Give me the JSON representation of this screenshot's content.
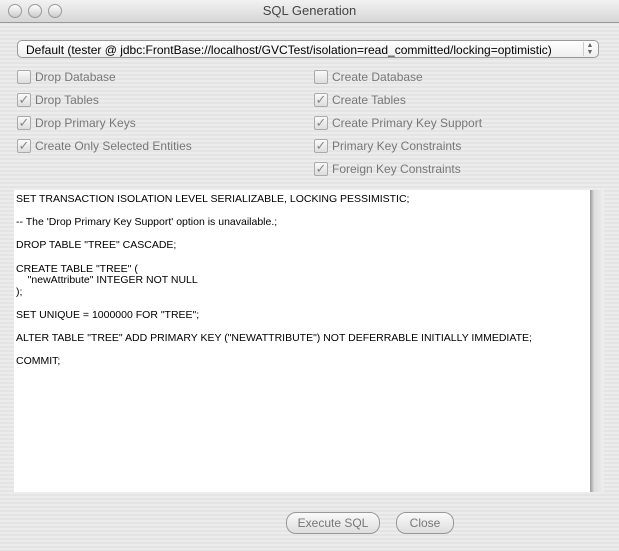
{
  "window": {
    "title": "SQL Generation"
  },
  "connection": {
    "selected": "Default (tester @ jdbc:FrontBase://localhost/GVCTest/isolation=read_committed/locking=optimistic)"
  },
  "options_left": [
    {
      "label": "Drop Database",
      "checked": false
    },
    {
      "label": "Drop Tables",
      "checked": true
    },
    {
      "label": "Drop Primary Keys",
      "checked": true
    },
    {
      "label": "Create Only Selected Entities",
      "checked": true
    }
  ],
  "options_right": [
    {
      "label": "Create Database",
      "checked": false
    },
    {
      "label": "Create Tables",
      "checked": true
    },
    {
      "label": "Create Primary Key Support",
      "checked": true
    },
    {
      "label": "Primary Key Constraints",
      "checked": true
    },
    {
      "label": "Foreign Key Constraints",
      "checked": true
    }
  ],
  "sql": "SET TRANSACTION ISOLATION LEVEL SERIALIZABLE, LOCKING PESSIMISTIC;\n\n-- The 'Drop Primary Key Support' option is unavailable.;\n\nDROP TABLE \"TREE\" CASCADE;\n\nCREATE TABLE \"TREE\" (\n\t\"newAttribute\" INTEGER NOT NULL\n);\n\nSET UNIQUE = 1000000 FOR \"TREE\";\n\nALTER TABLE \"TREE\" ADD PRIMARY KEY (\"NEWATTRIBUTE\") NOT DEFERRABLE INITIALLY IMMEDIATE;\n\nCOMMIT;",
  "buttons": {
    "execute": "Execute SQL",
    "close": "Close"
  }
}
